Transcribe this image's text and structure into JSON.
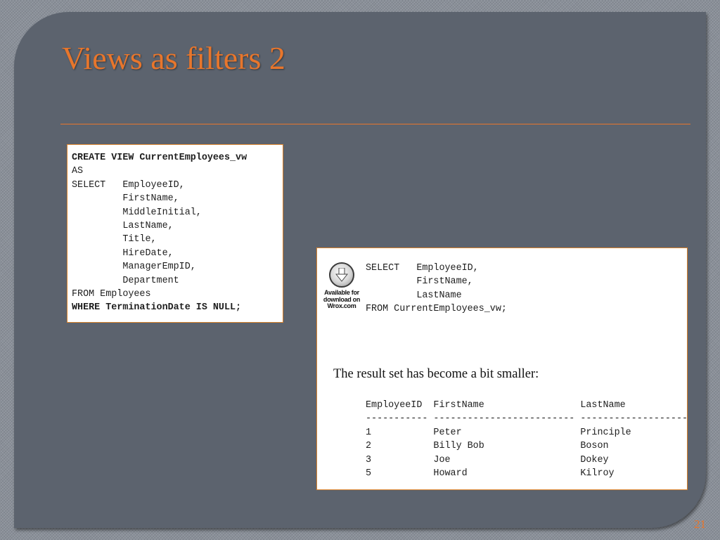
{
  "slide": {
    "title": "Views as filters 2",
    "page_number": "21"
  },
  "colors": {
    "accent": "#e8762c",
    "slide_background": "#5c636e",
    "panel_background": "#ffffff"
  },
  "view_definition": {
    "line_create": "CREATE VIEW CurrentEmployees_vw",
    "line_as": "AS",
    "line_select": "SELECT   EmployeeID,",
    "line_firstname": "         FirstName,",
    "line_middleinitial": "         MiddleInitial,",
    "line_lastname": "         LastName,",
    "line_title": "         Title,",
    "line_hiredate": "         HireDate,",
    "line_manager": "         ManagerEmpID,",
    "line_department": "         Department",
    "line_from": "FROM Employees",
    "line_where": "WHERE TerminationDate IS NULL;"
  },
  "query_example": {
    "badge_line1": "Available for",
    "badge_line2": "download on",
    "badge_line3": "Wrox.com",
    "badge_icon": "download-arrow-icon",
    "line_select": "SELECT   EmployeeID,",
    "line_firstname": "         FirstName,",
    "line_lastname": "         LastName",
    "line_from": "FROM CurrentEmployees_vw;",
    "caption": "The result set has become a bit smaller:",
    "result_header": "EmployeeID  FirstName                 LastName",
    "result_divider": "----------- ------------------------- -------------------------",
    "rows": [
      "1           Peter                     Principle",
      "2           Billy Bob                 Boson",
      "3           Joe                       Dokey",
      "5           Howard                    Kilroy"
    ]
  }
}
